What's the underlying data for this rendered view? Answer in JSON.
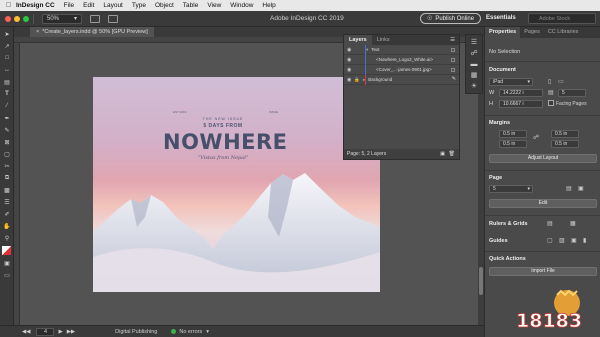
{
  "menubar": {
    "apple": "",
    "app_name": "InDesign CC",
    "items": [
      "File",
      "Edit",
      "Layout",
      "Type",
      "Object",
      "Table",
      "View",
      "Window",
      "Help"
    ]
  },
  "appbar": {
    "zoom": "50%",
    "title": "Adobe InDesign CC 2019",
    "publish_label": "Publish Online",
    "workspace": "Essentials",
    "search_placeholder": "Adobe Stock"
  },
  "document": {
    "tab_label": "*Create_layers.indd @ 50% [GPU Preview]",
    "tab_close": "×"
  },
  "artwork": {
    "tiny_top": "THE NEW ISSUE",
    "days": "5 DAYS FROM",
    "big": "NOWHERE",
    "sub": "“Vistas from Nepal”",
    "left_flank": "EST 2019",
    "right_flank": "ISSUE"
  },
  "layers_panel": {
    "tabs": [
      "Layers",
      "Links"
    ],
    "active_tab": "Layers",
    "rows": [
      {
        "name": "Text",
        "expanded": true,
        "indent": false
      },
      {
        "name": "<Nowhere_Logo2_White.ai>",
        "indent": true
      },
      {
        "name": "<Cover_...-james-0901.jpg>",
        "indent": true
      },
      {
        "name": "Background",
        "expanded": false,
        "indent": false
      }
    ],
    "footer": "Page: 5, 2 Layers"
  },
  "properties": {
    "tabs": [
      "Properties",
      "Pages",
      "CC Libraries"
    ],
    "active_tab": "Properties",
    "selection": "No Selection",
    "document_head": "Document",
    "preset": "iPad",
    "width_label": "W",
    "width": "14.2222 i",
    "height_label": "H",
    "height": "10.6667 i",
    "pages": "5",
    "facing_pages": "Facing Pages",
    "margins_head": "Margins",
    "margin_values": [
      "0.5 in",
      "0.5 in",
      "0.5 in",
      "0.5 in"
    ],
    "adjust_layout": "Adjust Layout",
    "page_head": "Page",
    "page_value": "5",
    "edit_button": "Edit",
    "rulers_grids": "Rulers & Grids",
    "guides": "Guides",
    "quick_actions": "Quick Actions",
    "import_file": "Import File"
  },
  "statusbar": {
    "page": "4",
    "preflight_profile": "Digital Publishing",
    "errors": "No errors"
  },
  "watermark": "18183",
  "colors": {
    "accent": "#4c6bdb",
    "status_ok": "#38b54a",
    "background_layer": "#d43b3b"
  }
}
